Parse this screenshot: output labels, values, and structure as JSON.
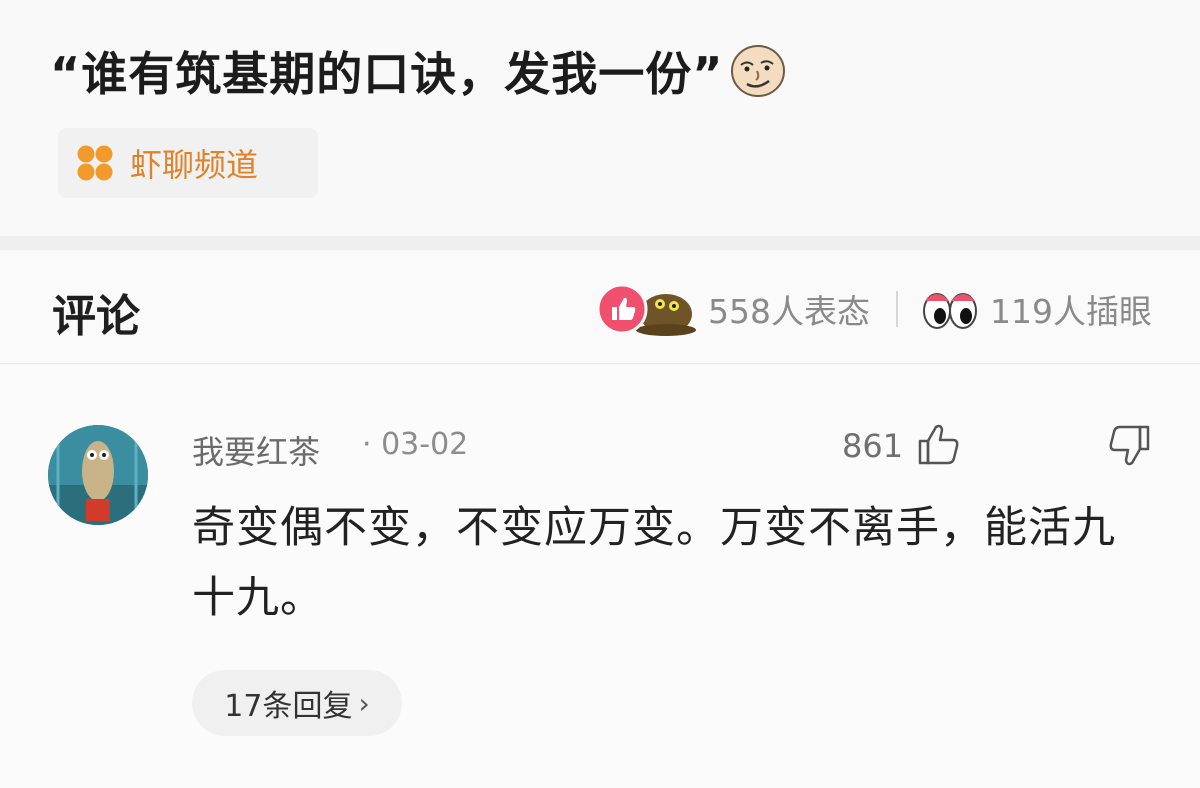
{
  "post": {
    "title": "“谁有筑基期的口诀，发我一份”",
    "channel": {
      "name": "虾聊频道",
      "icon": "four-petal-icon",
      "color": "#f08a24"
    }
  },
  "comments_section": {
    "title": "评论",
    "reactions_count_text": "558人表态",
    "watchers_count_text": "119人插眼"
  },
  "comment": {
    "username": "我要红茶",
    "dot": "·",
    "date": "03-02",
    "like_count": "861",
    "text": "奇变偶不变，不变应万变。万变不离手，能活九十九。",
    "replies_text": "17条回复",
    "replies_chevron": "›"
  },
  "colors": {
    "accent_orange": "#e0822a",
    "like_pink": "#f0506e",
    "muted_text": "#8a8a8a"
  }
}
